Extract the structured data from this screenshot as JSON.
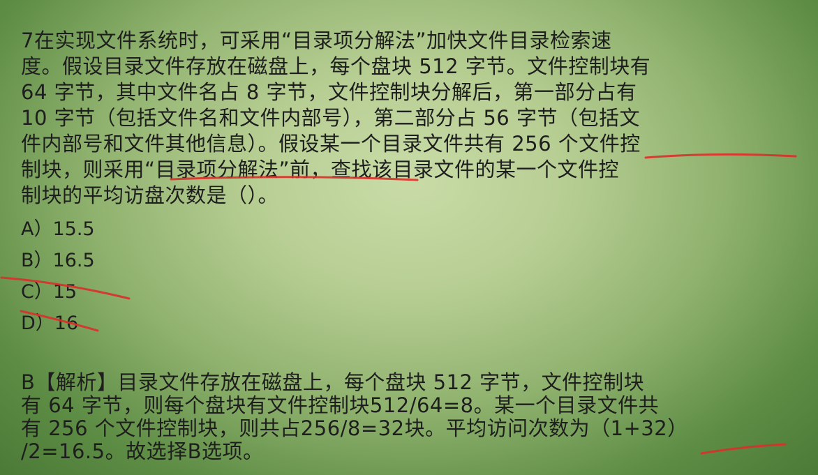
{
  "question": {
    "text": "7在实现文件系统时，可采用“目录项分解法”加快文件目录检索速\n度。假设目录文件存放在磁盘上，每个盘块 512 字节。文件控制块有\n64 字节，其中文件名占 8 字节，文件控制块分解后，第一部分占有\n10 字节（包括文件名和文件内部号），第二部分占 56 字节（包括文\n件内部号和文件其他信息）。假设某一个目录文件共有 256 个文件控\n制块，则采用“目录项分解法”前，查找该目录文件的某一个文件控\n制块的平均访盘次数是（）。"
  },
  "options": [
    {
      "label": "A）15.5"
    },
    {
      "label": "B）16.5"
    },
    {
      "label": "C）15"
    },
    {
      "label": "D）16"
    }
  ],
  "answer": {
    "text": "B【解析】目录文件存放在磁盘上，每个盘块 512 字节，文件控制块\n有 64 字节，则每个盘块有文件控制块512/64=8。某一个目录文件共\n有 256 个文件控制块，则共占256/8=32块。平均访问次数为（1+32）\n/2=16.5。故选择B选项。"
  },
  "annotation_color": "#d9302a"
}
